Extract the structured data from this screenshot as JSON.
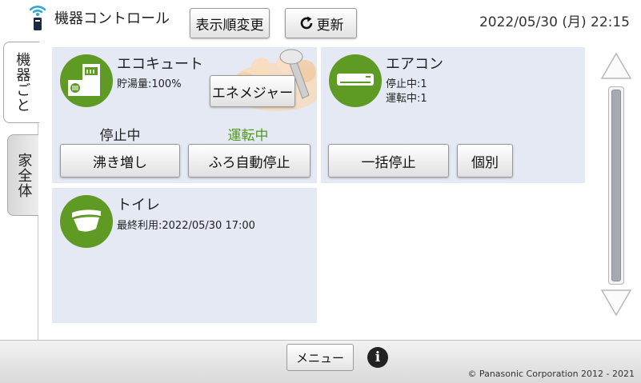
{
  "header": {
    "title": "機器コントロール",
    "order_button": "表示順変更",
    "refresh_button": "更新",
    "datetime": "2022/05/30 (月) 22:15"
  },
  "tabs": [
    {
      "label": "機器ごと",
      "active": true
    },
    {
      "label": "家全体",
      "active": false
    }
  ],
  "devices": {
    "ecocute": {
      "name": "エコキュート",
      "level": "貯湯量:100%",
      "energy_button": "エネメジャー",
      "status_left": "停止中",
      "status_right": "運転中",
      "button_left": "沸き増し",
      "button_right": "ふろ自動停止",
      "icon": "water-heater-icon"
    },
    "aircon": {
      "name": "エアコン",
      "stopped": "停止中:1",
      "running": "運転中:1",
      "button_stop_all": "一括停止",
      "button_individual": "個別",
      "icon": "air-conditioner-icon"
    },
    "toilet": {
      "name": "トイレ",
      "last_used": "最終利用:2022/05/30 17:00",
      "icon": "toilet-icon"
    }
  },
  "footer": {
    "menu_button": "メニュー",
    "copyright": "© Panasonic Corporation 2012 - 2021"
  },
  "colors": {
    "accent_green": "#5f9a24",
    "running_text": "#4f9a1e",
    "panel_bg": "#e4e9f4"
  }
}
